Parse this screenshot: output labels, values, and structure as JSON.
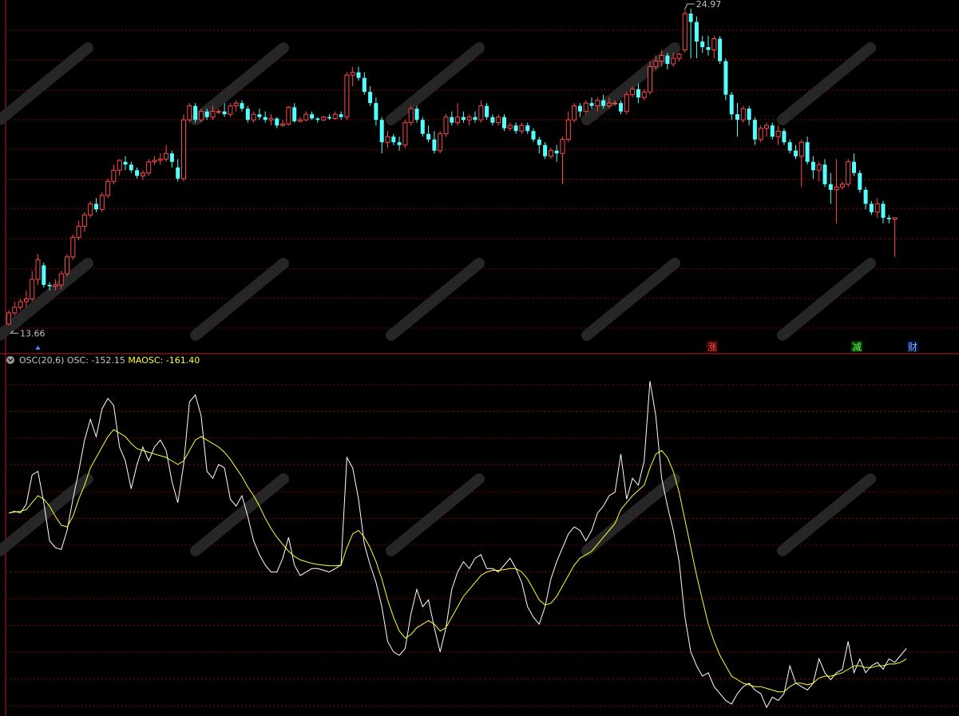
{
  "chart_data": [
    {
      "type": "candlestick",
      "title": "",
      "annotations": {
        "high_value": "24.97",
        "low_value": "13.66"
      },
      "markers": [
        "涨",
        "减",
        "财"
      ],
      "colors": {
        "up": "#ff4a4a",
        "down": "#54ffff",
        "grid": "#8b0000",
        "axis": "#b22222"
      },
      "grid": true,
      "candles": [
        [
          13.7,
          14.2,
          13.66,
          14.1
        ],
        [
          14.1,
          14.5,
          14.0,
          14.3
        ],
        [
          14.3,
          14.6,
          14.2,
          14.5
        ],
        [
          14.5,
          14.9,
          14.3,
          14.6
        ],
        [
          14.6,
          15.6,
          14.5,
          15.3
        ],
        [
          15.3,
          16.2,
          15.1,
          16.0
        ],
        [
          15.8,
          15.9,
          15.0,
          15.1
        ],
        [
          15.1,
          15.2,
          14.9,
          15.05
        ],
        [
          15.05,
          15.3,
          14.9,
          15.1
        ],
        [
          15.1,
          15.6,
          14.95,
          15.5
        ],
        [
          15.5,
          16.2,
          15.4,
          16.1
        ],
        [
          16.1,
          16.9,
          16.0,
          16.8
        ],
        [
          16.8,
          17.4,
          16.7,
          17.2
        ],
        [
          17.2,
          17.7,
          17.0,
          17.6
        ],
        [
          17.6,
          18.1,
          17.5,
          18.0
        ],
        [
          18.0,
          18.2,
          17.7,
          17.8
        ],
        [
          17.8,
          18.4,
          17.7,
          18.3
        ],
        [
          18.3,
          18.9,
          18.2,
          18.8
        ],
        [
          18.8,
          19.4,
          18.7,
          19.2
        ],
        [
          19.2,
          19.6,
          19.0,
          19.55
        ],
        [
          19.5,
          19.7,
          19.2,
          19.4
        ],
        [
          19.4,
          19.5,
          19.1,
          19.2
        ],
        [
          19.2,
          19.3,
          18.9,
          19.0
        ],
        [
          19.0,
          19.2,
          18.85,
          19.1
        ],
        [
          19.1,
          19.6,
          19.0,
          19.5
        ],
        [
          19.5,
          19.7,
          19.4,
          19.55
        ],
        [
          19.55,
          19.8,
          19.4,
          19.6
        ],
        [
          19.6,
          20.1,
          19.5,
          19.8
        ],
        [
          19.8,
          19.9,
          19.3,
          19.5
        ],
        [
          19.3,
          19.6,
          18.8,
          18.9
        ],
        [
          18.9,
          21.2,
          18.8,
          21.0
        ],
        [
          21.0,
          21.6,
          20.9,
          21.5
        ],
        [
          21.5,
          21.6,
          20.9,
          21.0
        ],
        [
          21.0,
          21.4,
          20.9,
          21.3
        ],
        [
          21.3,
          21.4,
          21.0,
          21.1
        ],
        [
          21.1,
          21.5,
          21.0,
          21.3
        ],
        [
          21.3,
          21.4,
          21.2,
          21.3
        ],
        [
          21.3,
          21.6,
          21.1,
          21.2
        ],
        [
          21.2,
          21.6,
          21.1,
          21.5
        ],
        [
          21.5,
          21.7,
          21.3,
          21.6
        ],
        [
          21.6,
          21.7,
          21.3,
          21.4
        ],
        [
          21.4,
          21.5,
          20.9,
          21.0
        ],
        [
          21.0,
          21.3,
          20.9,
          21.2
        ],
        [
          21.2,
          21.4,
          21.0,
          21.1
        ],
        [
          21.1,
          21.3,
          20.9,
          21.0
        ],
        [
          21.0,
          21.2,
          20.8,
          21.05
        ],
        [
          21.05,
          21.1,
          20.7,
          20.8
        ],
        [
          20.8,
          21.0,
          20.75,
          20.85
        ],
        [
          20.85,
          21.5,
          20.8,
          21.45
        ],
        [
          21.45,
          21.6,
          20.9,
          20.95
        ],
        [
          20.95,
          21.1,
          20.9,
          21.0
        ],
        [
          21.0,
          21.3,
          20.95,
          21.2
        ],
        [
          21.2,
          21.3,
          21.0,
          21.05
        ],
        [
          21.05,
          21.1,
          20.9,
          21.0
        ],
        [
          21.0,
          21.15,
          20.95,
          21.1
        ],
        [
          21.1,
          21.2,
          21.0,
          21.05
        ],
        [
          21.05,
          21.3,
          21.0,
          21.2
        ],
        [
          21.2,
          21.3,
          21.0,
          21.1
        ],
        [
          21.1,
          22.7,
          21.0,
          22.6
        ],
        [
          22.6,
          22.9,
          22.2,
          22.7
        ],
        [
          22.7,
          22.9,
          22.4,
          22.5
        ],
        [
          22.5,
          22.7,
          21.9,
          22.0
        ],
        [
          22.0,
          22.2,
          21.5,
          21.6
        ],
        [
          21.6,
          21.8,
          20.8,
          21.0
        ],
        [
          21.0,
          21.1,
          19.8,
          20.2
        ],
        [
          20.2,
          20.6,
          20.0,
          20.4
        ],
        [
          20.4,
          20.5,
          20.1,
          20.2
        ],
        [
          20.2,
          20.4,
          19.9,
          20.1
        ],
        [
          20.1,
          21.0,
          20.0,
          20.9
        ],
        [
          20.9,
          21.5,
          20.8,
          21.4
        ],
        [
          21.4,
          21.5,
          20.9,
          21.0
        ],
        [
          21.0,
          21.1,
          20.4,
          20.5
        ],
        [
          20.5,
          20.8,
          20.2,
          20.3
        ],
        [
          20.3,
          20.6,
          19.8,
          19.9
        ],
        [
          19.9,
          20.6,
          19.8,
          20.5
        ],
        [
          20.5,
          21.2,
          20.4,
          21.1
        ],
        [
          21.1,
          21.3,
          20.8,
          20.9
        ],
        [
          20.9,
          21.6,
          20.8,
          21.1
        ],
        [
          21.1,
          21.3,
          20.9,
          21.0
        ],
        [
          21.0,
          21.2,
          20.8,
          21.1
        ],
        [
          21.1,
          21.3,
          20.9,
          21.0
        ],
        [
          21.0,
          21.7,
          20.9,
          21.5
        ],
        [
          21.5,
          21.6,
          21.0,
          21.1
        ],
        [
          21.1,
          21.2,
          20.8,
          20.9
        ],
        [
          20.9,
          21.2,
          20.8,
          21.1
        ],
        [
          21.1,
          21.2,
          20.6,
          20.7
        ],
        [
          20.7,
          20.9,
          20.6,
          20.8
        ],
        [
          20.8,
          20.9,
          20.5,
          20.6
        ],
        [
          20.6,
          20.9,
          20.5,
          20.8
        ],
        [
          20.8,
          20.9,
          20.5,
          20.6
        ],
        [
          20.6,
          20.7,
          20.2,
          20.3
        ],
        [
          20.3,
          20.4,
          19.8,
          20.1
        ],
        [
          20.1,
          20.2,
          19.6,
          19.7
        ],
        [
          19.7,
          20.0,
          19.6,
          19.9
        ],
        [
          19.9,
          20.1,
          19.5,
          19.8
        ],
        [
          19.8,
          20.4,
          18.7,
          20.3
        ],
        [
          20.3,
          21.3,
          20.2,
          21.0
        ],
        [
          21.0,
          21.6,
          20.9,
          21.5
        ],
        [
          21.5,
          21.6,
          21.1,
          21.3
        ],
        [
          21.3,
          21.7,
          21.2,
          21.6
        ],
        [
          21.6,
          21.8,
          21.4,
          21.5
        ],
        [
          21.5,
          21.8,
          21.3,
          21.7
        ],
        [
          21.7,
          21.9,
          21.4,
          21.5
        ],
        [
          21.5,
          21.8,
          21.4,
          21.6
        ],
        [
          21.6,
          21.7,
          21.5,
          21.6
        ],
        [
          21.6,
          21.7,
          21.2,
          21.3
        ],
        [
          21.3,
          22.0,
          21.2,
          21.9
        ],
        [
          21.9,
          22.2,
          21.8,
          22.1
        ],
        [
          22.1,
          22.3,
          21.6,
          21.8
        ],
        [
          21.8,
          22.1,
          21.7,
          22.0
        ],
        [
          22.0,
          23.1,
          21.9,
          22.9
        ],
        [
          22.9,
          23.3,
          22.8,
          23.1
        ],
        [
          23.1,
          23.5,
          22.9,
          23.3
        ],
        [
          23.3,
          23.4,
          22.8,
          23.0
        ],
        [
          23.0,
          23.4,
          22.9,
          23.2
        ],
        [
          23.2,
          23.4,
          23.1,
          23.35
        ],
        [
          23.5,
          24.97,
          23.4,
          24.8
        ],
        [
          24.8,
          24.97,
          23.2,
          24.5
        ],
        [
          24.5,
          24.7,
          23.2,
          23.8
        ],
        [
          23.8,
          24.0,
          23.4,
          23.6
        ],
        [
          23.6,
          24.0,
          23.3,
          23.5
        ],
        [
          23.5,
          24.0,
          23.2,
          23.9
        ],
        [
          23.9,
          24.0,
          23.0,
          23.1
        ],
        [
          23.1,
          23.2,
          21.7,
          21.9
        ],
        [
          21.9,
          22.0,
          21.0,
          21.2
        ],
        [
          21.2,
          21.6,
          20.4,
          21.0
        ],
        [
          21.0,
          21.5,
          20.9,
          21.4
        ],
        [
          21.4,
          21.5,
          20.8,
          21.0
        ],
        [
          21.0,
          21.1,
          20.1,
          20.3
        ],
        [
          20.3,
          20.8,
          20.2,
          20.7
        ],
        [
          20.7,
          20.9,
          20.4,
          20.8
        ],
        [
          20.8,
          20.9,
          20.3,
          20.4
        ],
        [
          20.4,
          20.8,
          20.1,
          20.6
        ],
        [
          20.6,
          20.7,
          20.1,
          20.2
        ],
        [
          20.2,
          20.3,
          19.8,
          19.9
        ],
        [
          19.9,
          20.1,
          19.6,
          19.7
        ],
        [
          19.7,
          20.3,
          18.6,
          20.2
        ],
        [
          20.2,
          20.4,
          19.4,
          19.5
        ],
        [
          19.5,
          19.7,
          18.9,
          19.2
        ],
        [
          19.2,
          19.5,
          18.8,
          19.4
        ],
        [
          19.4,
          19.6,
          18.6,
          18.7
        ],
        [
          18.7,
          19.1,
          18.0,
          18.5
        ],
        [
          18.5,
          19.6,
          17.3,
          18.6
        ],
        [
          18.6,
          18.8,
          18.5,
          18.7
        ],
        [
          18.7,
          19.6,
          18.6,
          19.5
        ],
        [
          19.5,
          19.8,
          19.0,
          19.1
        ],
        [
          19.1,
          19.2,
          18.4,
          18.5
        ],
        [
          18.5,
          18.6,
          17.8,
          18.0
        ],
        [
          18.0,
          18.1,
          17.6,
          17.7
        ],
        [
          17.7,
          18.2,
          17.5,
          18.0
        ],
        [
          18.0,
          18.1,
          17.3,
          17.5
        ],
        [
          17.5,
          17.6,
          17.3,
          17.45
        ],
        [
          17.45,
          17.5,
          16.1,
          17.5
        ]
      ]
    },
    {
      "type": "line",
      "title": "OSC(20,6)",
      "legend": [
        {
          "name": "OSC",
          "value": "-152.15",
          "color": "#ffffff"
        },
        {
          "name": "MAOSC",
          "value": "-161.40",
          "color": "#ffff33"
        }
      ],
      "grid": true,
      "series": [
        {
          "name": "OSC",
          "color": "#ffffff",
          "values": [
            20,
            25,
            20,
            45,
            130,
            140,
            50,
            -60,
            -80,
            -85,
            -30,
            60,
            140,
            230,
            290,
            240,
            320,
            350,
            330,
            210,
            170,
            90,
            160,
            210,
            170,
            210,
            230,
            200,
            110,
            50,
            160,
            340,
            360,
            300,
            140,
            120,
            160,
            150,
            60,
            40,
            70,
            10,
            -60,
            -100,
            -130,
            -150,
            -150,
            -110,
            -50,
            -130,
            -160,
            -150,
            -140,
            -140,
            -145,
            -150,
            -140,
            -130,
            180,
            150,
            60,
            -70,
            -130,
            -180,
            -250,
            -350,
            -380,
            -390,
            -370,
            -270,
            -200,
            -250,
            -230,
            -310,
            -380,
            -310,
            -200,
            -150,
            -120,
            -140,
            -110,
            -100,
            -140,
            -140,
            -150,
            -130,
            -110,
            -140,
            -180,
            -250,
            -280,
            -300,
            -250,
            -170,
            -120,
            -80,
            -40,
            -20,
            -30,
            -60,
            -30,
            20,
            40,
            70,
            80,
            190,
            60,
            120,
            100,
            170,
            400,
            300,
            120,
            40,
            -30,
            -120,
            -280,
            -380,
            -420,
            -450,
            -440,
            -480,
            -500,
            -520,
            -530,
            -500,
            -480,
            -470,
            -490,
            -500,
            -540,
            -510,
            -520,
            -500,
            -420,
            -470,
            -480,
            -490,
            -470,
            -400,
            -440,
            -460,
            -440,
            -430,
            -350,
            -440,
            -400,
            -440,
            -420,
            -410,
            -430,
            -400,
            -410,
            -390,
            -370
          ]
        },
        {
          "name": "MAOSC",
          "color": "#ffff33",
          "values": [
            20,
            23,
            25,
            30,
            50,
            70,
            60,
            40,
            10,
            -15,
            -20,
            10,
            60,
            100,
            150,
            180,
            210,
            240,
            260,
            250,
            240,
            220,
            205,
            200,
            195,
            190,
            185,
            180,
            170,
            160,
            170,
            200,
            230,
            240,
            230,
            220,
            210,
            195,
            175,
            150,
            125,
            95,
            70,
            40,
            5,
            -25,
            -50,
            -70,
            -90,
            -105,
            -115,
            -120,
            -125,
            -128,
            -130,
            -132,
            -132,
            -130,
            -80,
            -40,
            -30,
            -50,
            -80,
            -120,
            -170,
            -230,
            -280,
            -320,
            -340,
            -330,
            -310,
            -300,
            -290,
            -300,
            -320,
            -310,
            -280,
            -250,
            -220,
            -200,
            -180,
            -160,
            -150,
            -145,
            -145,
            -143,
            -140,
            -140,
            -150,
            -170,
            -200,
            -230,
            -245,
            -240,
            -220,
            -190,
            -160,
            -130,
            -110,
            -100,
            -90,
            -70,
            -50,
            -30,
            -10,
            30,
            50,
            70,
            85,
            100,
            150,
            190,
            200,
            180,
            140,
            80,
            0,
            -80,
            -160,
            -230,
            -300,
            -350,
            -390,
            -420,
            -450,
            -460,
            -470,
            -475,
            -480,
            -480,
            -485,
            -490,
            -495,
            -495,
            -480,
            -470,
            -470,
            -475,
            -470,
            -455,
            -450,
            -450,
            -445,
            -440,
            -430,
            -420,
            -420,
            -425,
            -425,
            -420,
            -420,
            -415,
            -415,
            -410,
            -400
          ]
        }
      ]
    }
  ]
}
